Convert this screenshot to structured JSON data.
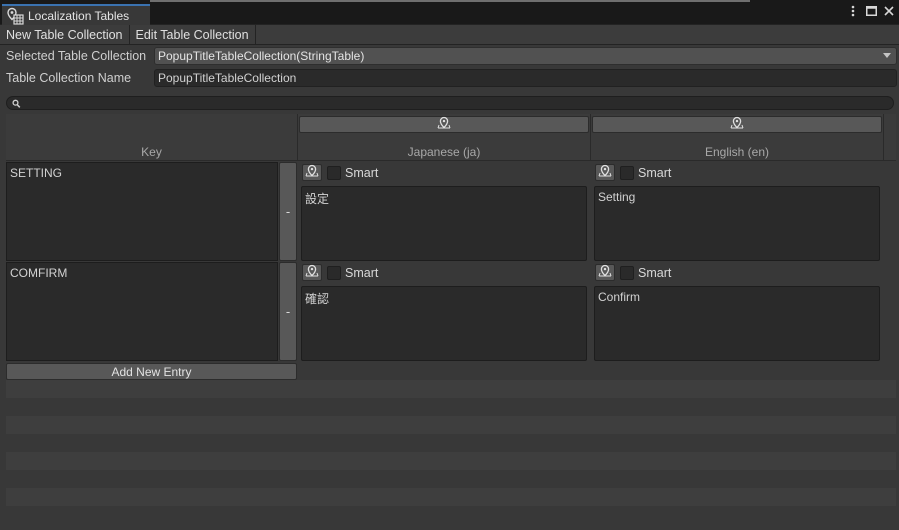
{
  "window": {
    "tab_title": "Localization Tables",
    "tab_icon": "globe-table-icon",
    "controls": [
      "kebab-menu-icon",
      "maximize-icon",
      "close-icon"
    ]
  },
  "toolbar": {
    "new_collection": "New Table Collection",
    "edit_collection": "Edit Table Collection"
  },
  "fields": {
    "selected_label": "Selected Table Collection",
    "selected_value": "PopupTitleTableCollection(StringTable)",
    "name_label": "Table Collection Name",
    "name_value": "PopupTitleTableCollection"
  },
  "search": {
    "icon": "search-icon",
    "value": ""
  },
  "table": {
    "columns": {
      "key": "Key",
      "locale_1": "Japanese (ja)",
      "locale_2": "English (en)"
    },
    "locale_icon": "locale-settings-icon",
    "smart_label": "Smart",
    "remove_label": "-",
    "rows": [
      {
        "key": "SETTING",
        "ja": "設定",
        "en": "Setting"
      },
      {
        "key": "COMFIRM",
        "ja": "確認",
        "en": "Confirm"
      }
    ],
    "add_entry": "Add New Entry"
  },
  "colors": {
    "background": "#383838",
    "tab_accent": "#3a72b0",
    "field_bg": "#2a2a2a",
    "button_bg": "#585858"
  }
}
